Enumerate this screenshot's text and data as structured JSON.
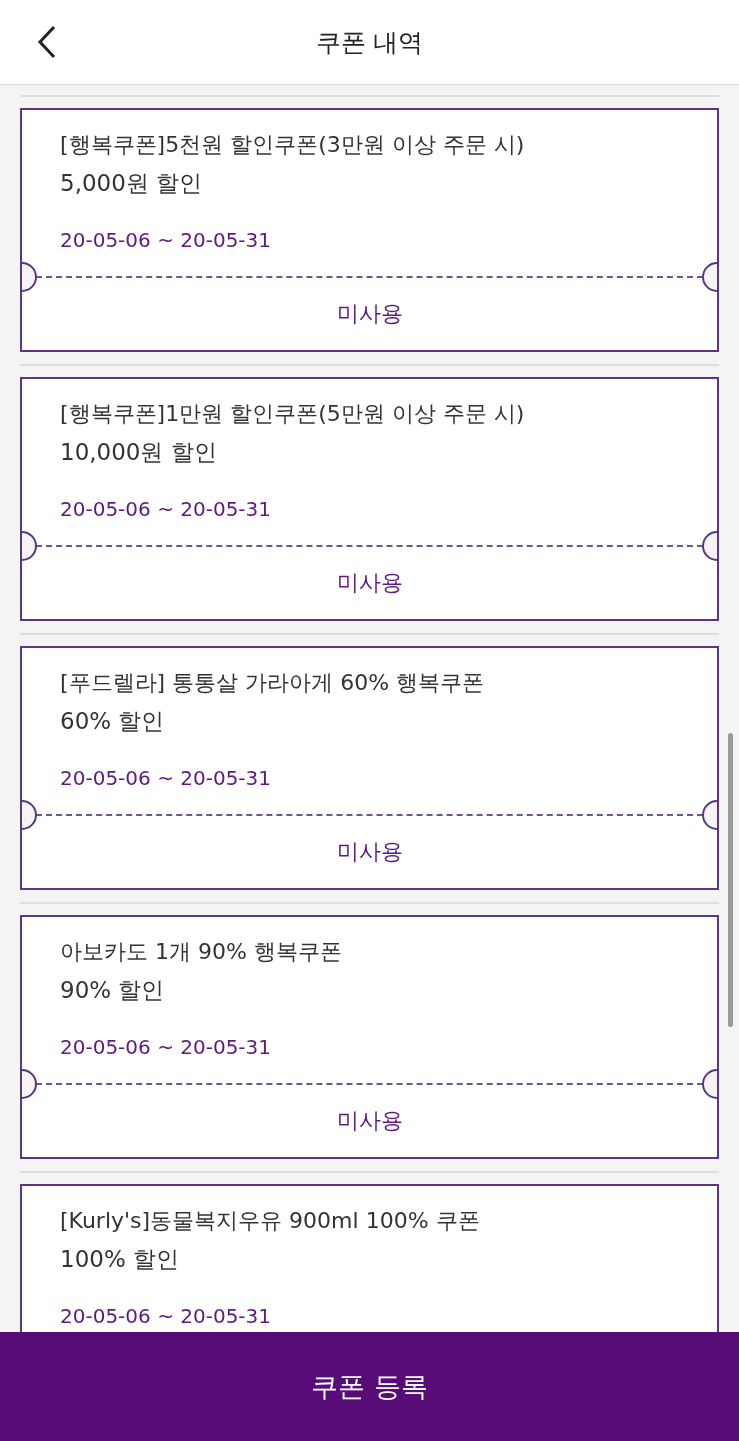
{
  "header": {
    "title": "쿠폰 내역"
  },
  "coupons": [
    {
      "title": "[행복쿠폰]5천원 할인쿠폰(3만원 이상 주문 시)",
      "discount": "5,000원 할인",
      "period": "20-05-06 ~ 20-05-31",
      "status": "미사용"
    },
    {
      "title": "[행복쿠폰]1만원 할인쿠폰(5만원 이상 주문 시)",
      "discount": "10,000원 할인",
      "period": "20-05-06 ~ 20-05-31",
      "status": "미사용"
    },
    {
      "title": "[푸드렐라] 통통살 가라아게 60% 행복쿠폰",
      "discount": "60% 할인",
      "period": "20-05-06 ~ 20-05-31",
      "status": "미사용"
    },
    {
      "title": "아보카도 1개 90% 행복쿠폰",
      "discount": "90% 할인",
      "period": "20-05-06 ~ 20-05-31",
      "status": "미사용"
    },
    {
      "title": "[Kurly's]동물복지우유 900ml 100% 쿠폰",
      "discount": "100% 할인",
      "period": "20-05-06 ~ 20-05-31"
    }
  ],
  "register_button": {
    "label": "쿠폰 등록"
  }
}
